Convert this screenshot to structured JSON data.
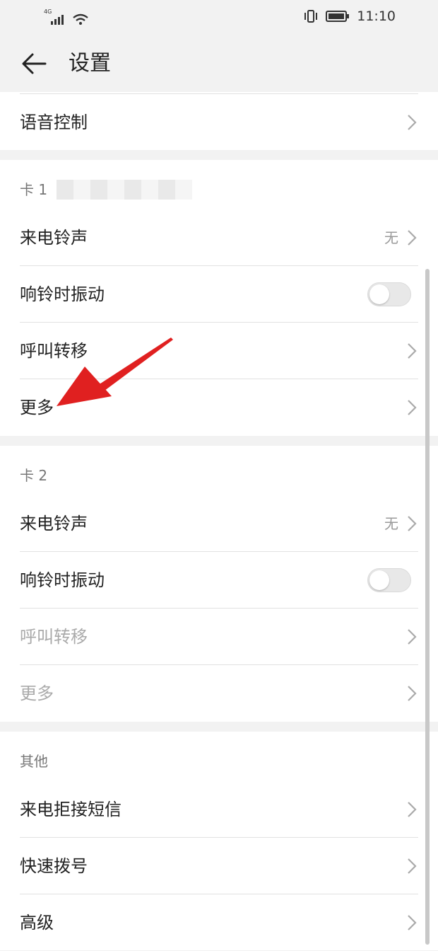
{
  "status_bar": {
    "network": "4G",
    "time": "11:10"
  },
  "header": {
    "title": "设置"
  },
  "voice_control": {
    "label": "语音控制"
  },
  "sim1": {
    "title": "卡 1",
    "ringtone": {
      "label": "来电铃声",
      "value": "无"
    },
    "vibrate": {
      "label": "响铃时振动",
      "on": false
    },
    "call_forwarding": {
      "label": "呼叫转移"
    },
    "more": {
      "label": "更多"
    }
  },
  "sim2": {
    "title": "卡 2",
    "ringtone": {
      "label": "来电铃声",
      "value": "无"
    },
    "vibrate": {
      "label": "响铃时振动",
      "on": false
    },
    "call_forwarding": {
      "label": "呼叫转移"
    },
    "more": {
      "label": "更多"
    }
  },
  "other": {
    "title": "其他",
    "reject_sms": {
      "label": "来电拒接短信"
    },
    "speed_dial": {
      "label": "快速拨号"
    },
    "advanced": {
      "label": "高级"
    }
  },
  "colors": {
    "annotation_arrow": "#e02020",
    "background": "#f2f2f2"
  },
  "icons": [
    "signal-icon",
    "wifi-icon",
    "vibrate-icon",
    "battery-icon",
    "back-arrow-icon",
    "chevron-right-icon"
  ]
}
